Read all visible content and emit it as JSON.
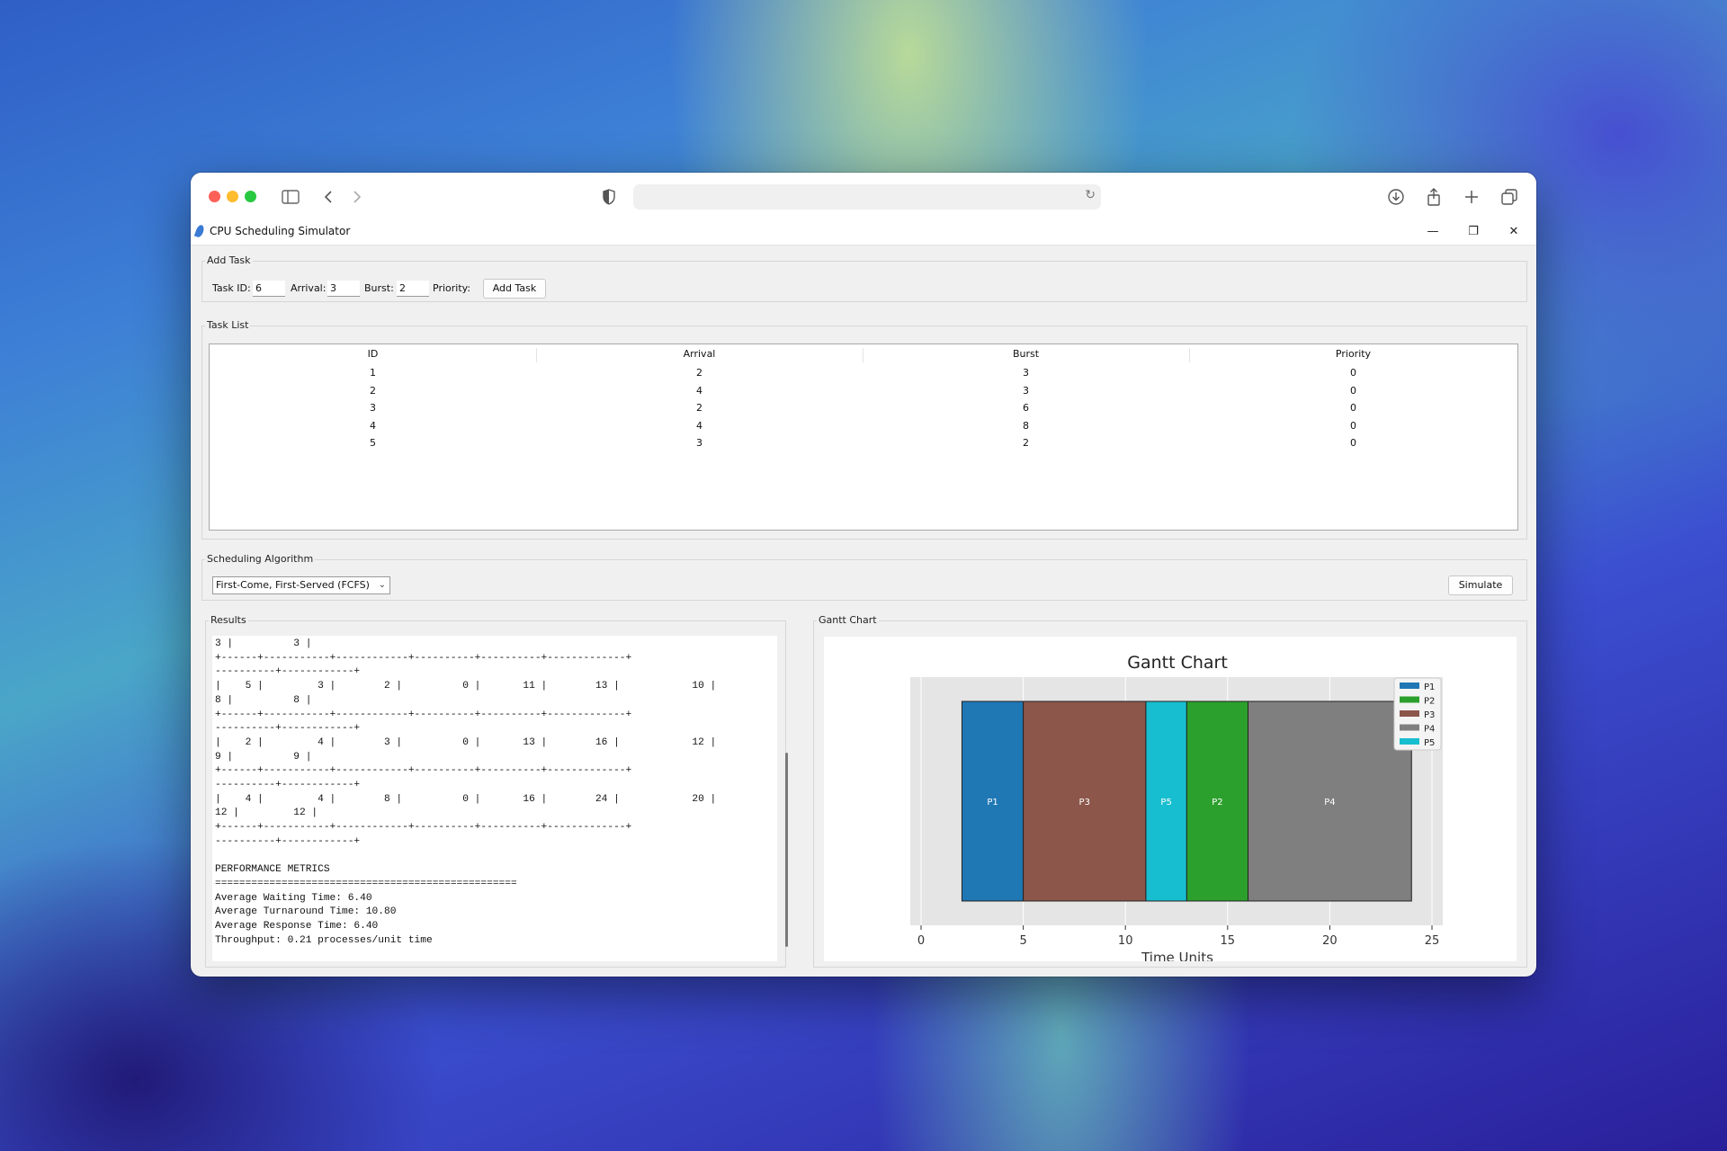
{
  "browser": {
    "icons": [
      "sidebar-icon",
      "back-icon",
      "forward-icon",
      "shield-icon",
      "reload-icon",
      "download-icon",
      "share-icon",
      "new-tab-icon",
      "tabs-icon"
    ]
  },
  "window": {
    "title": "CPU Scheduling Simulator",
    "minimize": "—",
    "restore": "❐",
    "close": "✕"
  },
  "add_task": {
    "group_label": "Add Task",
    "task_id_label": "Task ID:",
    "task_id_value": "6",
    "arrival_label": "Arrival:",
    "arrival_value": "3",
    "burst_label": "Burst:",
    "burst_value": "2",
    "priority_label": "Priority:",
    "add_button": "Add Task"
  },
  "task_list": {
    "group_label": "Task List",
    "columns": [
      "ID",
      "Arrival",
      "Burst",
      "Priority"
    ],
    "rows": [
      [
        "1",
        "2",
        "3",
        "0"
      ],
      [
        "2",
        "4",
        "3",
        "0"
      ],
      [
        "3",
        "2",
        "6",
        "0"
      ],
      [
        "4",
        "4",
        "8",
        "0"
      ],
      [
        "5",
        "3",
        "2",
        "0"
      ]
    ]
  },
  "algorithm": {
    "group_label": "Scheduling Algorithm",
    "selected": "First-Come, First-Served (FCFS)",
    "simulate_button": "Simulate"
  },
  "results": {
    "group_label": "Results",
    "lines": [
      "3 |          3 |",
      "+------+-----------+------------+----------+----------+-------------+",
      "----------+------------+",
      "|    5 |         3 |        2 |          0 |       11 |        13 |            10 |",
      "8 |          8 |",
      "+------+-----------+------------+----------+----------+-------------+",
      "----------+------------+",
      "|    2 |         4 |        3 |          0 |       13 |        16 |            12 |",
      "9 |          9 |",
      "+------+-----------+------------+----------+----------+-------------+",
      "----------+------------+",
      "|    4 |         4 |        8 |          0 |       16 |        24 |            20 |",
      "12 |         12 |",
      "+------+-----------+------------+----------+----------+-------------+",
      "----------+------------+",
      "",
      "PERFORMANCE METRICS",
      "==================================================",
      "Average Waiting Time: 6.40",
      "Average Turnaround Time: 10.80",
      "Average Response Time: 6.40",
      "Throughput: 0.21 processes/unit time"
    ]
  },
  "gantt": {
    "group_label": "Gantt Chart"
  },
  "chart_data": {
    "type": "bar",
    "orientation": "horizontal-gantt",
    "title": "Gantt Chart",
    "xlabel": "Time Units",
    "ylabel": "",
    "xlim": [
      0,
      25
    ],
    "xticks": [
      0,
      5,
      10,
      15,
      20,
      25
    ],
    "grid": true,
    "legend_position": "top-right",
    "series": [
      {
        "name": "P1",
        "color": "#1f77b4"
      },
      {
        "name": "P2",
        "color": "#2ca02c"
      },
      {
        "name": "P3",
        "color": "#8c564b"
      },
      {
        "name": "P4",
        "color": "#7f7f7f"
      },
      {
        "name": "P5",
        "color": "#17becf"
      }
    ],
    "segments": [
      {
        "label": "P1",
        "start": 2,
        "end": 5,
        "color": "#1f77b4"
      },
      {
        "label": "P3",
        "start": 5,
        "end": 11,
        "color": "#8c564b"
      },
      {
        "label": "P5",
        "start": 11,
        "end": 13,
        "color": "#17becf"
      },
      {
        "label": "P2",
        "start": 13,
        "end": 16,
        "color": "#2ca02c"
      },
      {
        "label": "P4",
        "start": 16,
        "end": 24,
        "color": "#7f7f7f"
      }
    ]
  }
}
